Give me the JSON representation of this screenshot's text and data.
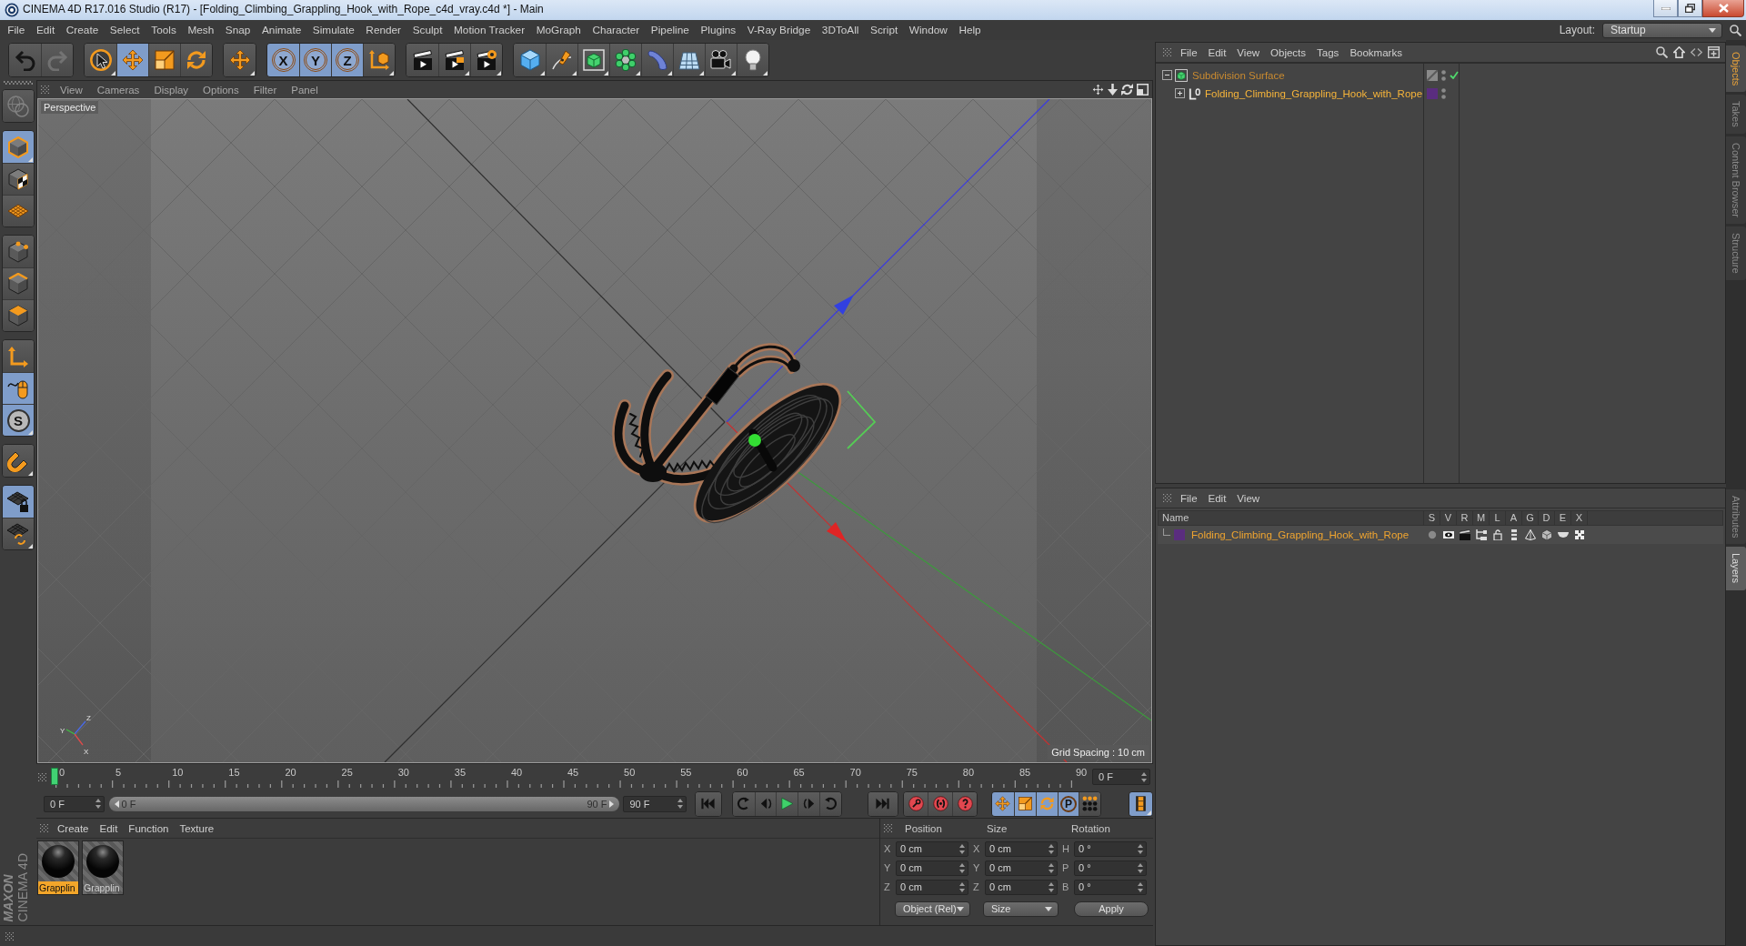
{
  "window": {
    "title": "CINEMA 4D R17.016 Studio (R17) - [Folding_Climbing_Grappling_Hook_with_Rope_c4d_vray.c4d *] - Main"
  },
  "menu_bar": {
    "items": [
      "File",
      "Edit",
      "Create",
      "Select",
      "Tools",
      "Mesh",
      "Snap",
      "Animate",
      "Simulate",
      "Render",
      "Sculpt",
      "Motion Tracker",
      "MoGraph",
      "Character",
      "Pipeline",
      "Plugins",
      "V-Ray Bridge",
      "3DToAll",
      "Script",
      "Window",
      "Help"
    ],
    "layout_label": "Layout:",
    "layout_value": "Startup"
  },
  "toolbar": {
    "groups": [
      {
        "buttons": [
          {
            "kind": "undo",
            "selected": false,
            "disabled": false,
            "submenu": false
          },
          {
            "kind": "redo",
            "selected": false,
            "disabled": true,
            "submenu": false
          }
        ]
      },
      {
        "buttons": [
          {
            "kind": "select",
            "selected": false,
            "submenu": true
          },
          {
            "kind": "move",
            "selected": true,
            "submenu": false
          },
          {
            "kind": "scale",
            "selected": false,
            "submenu": false
          },
          {
            "kind": "rotate",
            "selected": false,
            "submenu": false
          }
        ]
      },
      {
        "buttons": [
          {
            "kind": "recent",
            "selected": false,
            "submenu": true
          }
        ]
      },
      {
        "buttons": [
          {
            "kind": "axislock",
            "label": "X",
            "selected": true,
            "submenu": false
          },
          {
            "kind": "axislock",
            "label": "Y",
            "selected": true,
            "submenu": false
          },
          {
            "kind": "axislock",
            "label": "Z",
            "selected": true,
            "submenu": false
          },
          {
            "kind": "coords",
            "selected": false,
            "submenu": true
          }
        ]
      },
      {
        "buttons": [
          {
            "kind": "render",
            "selected": false,
            "submenu": false
          },
          {
            "kind": "renderviewer",
            "selected": false,
            "submenu": true
          },
          {
            "kind": "rendersettings",
            "selected": false,
            "submenu": true
          }
        ]
      },
      {
        "buttons": [
          {
            "kind": "cube",
            "selected": false,
            "submenu": true
          },
          {
            "kind": "pen",
            "selected": false,
            "submenu": true
          },
          {
            "kind": "subdivision",
            "selected": false,
            "submenu": true
          },
          {
            "kind": "cloner",
            "selected": false,
            "submenu": true
          },
          {
            "kind": "deformer",
            "selected": false,
            "submenu": true
          },
          {
            "kind": "floor",
            "selected": false,
            "submenu": true
          },
          {
            "kind": "camera",
            "selected": false,
            "submenu": true
          },
          {
            "kind": "light",
            "selected": false,
            "submenu": true
          }
        ]
      }
    ]
  },
  "tool_palette": {
    "groups": [
      {
        "buttons": [
          {
            "kind": "editable",
            "selected": false,
            "disabled": true,
            "submenu": false
          }
        ]
      },
      {
        "buttons": [
          {
            "kind": "model",
            "selected": true,
            "submenu": true
          },
          {
            "kind": "texture",
            "selected": false,
            "submenu": false
          },
          {
            "kind": "workplane",
            "selected": false,
            "submenu": false
          }
        ]
      },
      {
        "buttons": [
          {
            "kind": "points",
            "selected": false,
            "submenu": false
          },
          {
            "kind": "edges",
            "selected": false,
            "submenu": false
          },
          {
            "kind": "polygons",
            "selected": false,
            "submenu": false
          }
        ]
      },
      {
        "buttons": [
          {
            "kind": "axismode",
            "selected": false,
            "submenu": false
          },
          {
            "kind": "tweak",
            "selected": true,
            "submenu": false
          },
          {
            "kind": "snap",
            "label": "S",
            "selected": true,
            "submenu": true
          }
        ]
      },
      {
        "buttons": [
          {
            "kind": "magnet",
            "selected": false,
            "submenu": true
          }
        ]
      },
      {
        "buttons": [
          {
            "kind": "gridlock",
            "selected": true,
            "submenu": false
          },
          {
            "kind": "gridrotate",
            "selected": false,
            "submenu": true
          }
        ]
      }
    ]
  },
  "viewport": {
    "menu": [
      "View",
      "Cameras",
      "Display",
      "Options",
      "Filter",
      "Panel"
    ],
    "camera": "Perspective",
    "grid_spacing": "Grid Spacing : 10 cm",
    "axis_labels": [
      "Z",
      "Y",
      "X"
    ]
  },
  "timeline": {
    "ruler": [
      "0",
      "5",
      "10",
      "15",
      "20",
      "25",
      "30",
      "35",
      "40",
      "45",
      "50",
      "55",
      "60",
      "65",
      "70",
      "75",
      "80",
      "85",
      "90"
    ],
    "playhead": {
      "level": 0
    },
    "current_frame": "0 F"
  },
  "transport": {
    "start_frame": "0 F",
    "range": {
      "start": "0 F",
      "end": "90 F"
    },
    "end_frame": "90 F",
    "groups": [
      {
        "buttons": [
          {
            "kind": "gostart"
          }
        ]
      },
      {
        "buttons": [
          {
            "kind": "prevkey"
          },
          {
            "kind": "prevframe"
          },
          {
            "kind": "play"
          },
          {
            "kind": "nextframe"
          },
          {
            "kind": "nextkey"
          }
        ]
      },
      {
        "buttons": [
          {
            "kind": "goend"
          }
        ]
      },
      {
        "buttons": [
          {
            "kind": "recordkey"
          },
          {
            "kind": "autokey"
          },
          {
            "kind": "keysel"
          }
        ]
      },
      {
        "buttons": [
          {
            "kind": "kmove",
            "selected": true
          },
          {
            "kind": "kscale",
            "selected": true
          },
          {
            "kind": "krotate",
            "selected": true
          },
          {
            "kind": "kparam",
            "label": "P",
            "selected": true
          },
          {
            "kind": "kpoints",
            "selected": false
          }
        ]
      },
      {
        "buttons": [
          {
            "kind": "timeline",
            "selected": true,
            "submenu": true
          }
        ]
      }
    ]
  },
  "material_manager": {
    "menu": [
      "Create",
      "Edit",
      "Function",
      "Texture"
    ],
    "materials": [
      {
        "name": "Grapplin",
        "selected": true
      },
      {
        "name": "Grapplin",
        "selected": false
      }
    ]
  },
  "coordinates": {
    "headers": [
      "Position",
      "Size",
      "Rotation"
    ],
    "rows": [
      {
        "cells": [
          {
            "axis": "X",
            "value": "0 cm"
          },
          {
            "axis": "X",
            "value": "0 cm"
          },
          {
            "axis": "H",
            "value": "0 °"
          }
        ]
      },
      {
        "cells": [
          {
            "axis": "Y",
            "value": "0 cm"
          },
          {
            "axis": "Y",
            "value": "0 cm"
          },
          {
            "axis": "P",
            "value": "0 °"
          }
        ]
      },
      {
        "cells": [
          {
            "axis": "Z",
            "value": "0 cm"
          },
          {
            "axis": "Z",
            "value": "0 cm"
          },
          {
            "axis": "B",
            "value": "0 °"
          }
        ]
      }
    ],
    "dropdowns": [
      "Object (Rel)",
      "Size"
    ],
    "apply_button": "Apply"
  },
  "logo": {
    "brand": "MAXON",
    "product": "CINEMA 4D"
  },
  "object_manager": {
    "menu": [
      "File",
      "Edit",
      "View",
      "Objects",
      "Tags",
      "Bookmarks"
    ],
    "tree": [
      {
        "name": "Subdivision Surface",
        "kind": "subdivision",
        "selected": false,
        "expanded": true,
        "enabled": true,
        "children": [
          {
            "name": "Folding_Climbing_Grappling_Hook_with_Rope",
            "kind": "null",
            "selected": true,
            "expanded": false,
            "color": "#5a2d7f"
          }
        ]
      }
    ]
  },
  "layer_manager": {
    "menu": [
      "File",
      "Edit",
      "View"
    ],
    "columns": [
      "Name",
      "S",
      "V",
      "R",
      "M",
      "L",
      "A",
      "G",
      "D",
      "E",
      "X"
    ],
    "layers": [
      {
        "name": "Folding_Climbing_Grappling_Hook_with_Rope",
        "color": "#5a2d7f"
      }
    ]
  },
  "side_tabs": {
    "top": [
      {
        "label": "Objects",
        "selected": true
      },
      {
        "label": "Takes",
        "selected": false
      },
      {
        "label": "Content Browser",
        "selected": false
      },
      {
        "label": "Structure",
        "selected": false
      }
    ],
    "bottom": [
      {
        "label": "Attributes",
        "selected": false
      },
      {
        "label": "Layers",
        "selected": true
      }
    ]
  }
}
